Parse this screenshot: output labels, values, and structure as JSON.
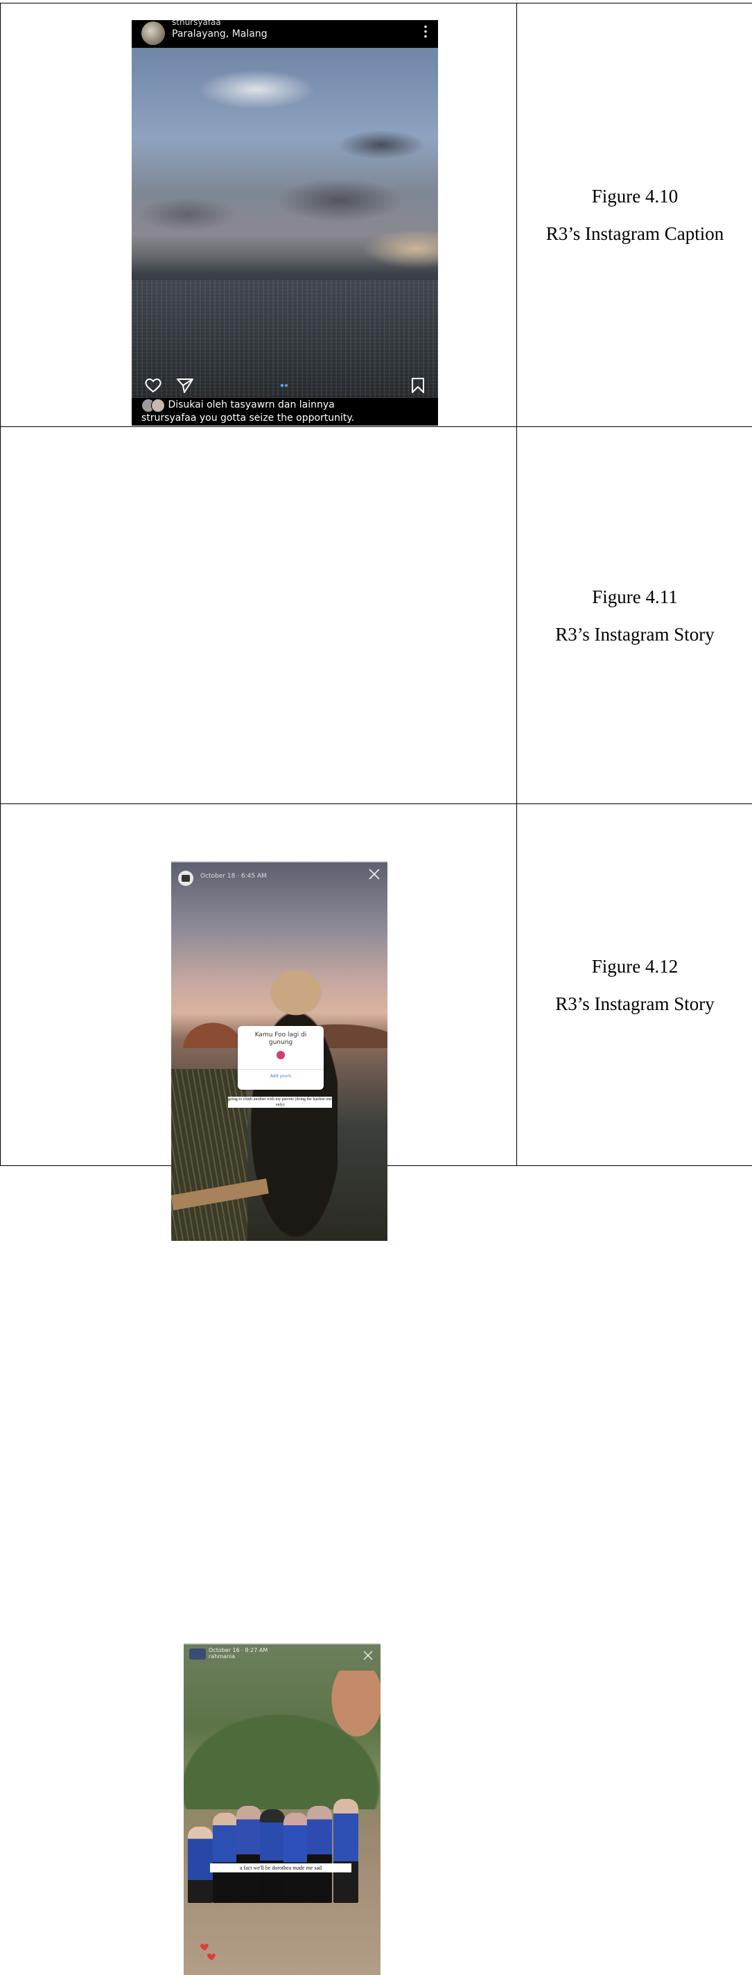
{
  "figures": [
    {
      "number": "Figure 4.10",
      "caption": "R3’s Instagram Caption"
    },
    {
      "number": "Figure 4.11",
      "caption": "R3’s Instagram Story"
    },
    {
      "number": "Figure 4.12",
      "caption": "R3’s Instagram Story"
    }
  ],
  "post": {
    "username": "stnursyafaa",
    "location": "Paralayang, Malang",
    "likes_text": "Disukai oleh tasyawrn dan lainnya",
    "caption_user": "strursyafaa",
    "caption_text": " you gotta seize the opportunity.",
    "accent": "#4aa3ff"
  },
  "story1": {
    "meta": "October 18 · 6:45 AM",
    "question": "Kamu Foo lagi di gunung",
    "reply_label": "Add yours",
    "text": "going to climb another with my parents (doing the hardest one only)"
  },
  "story2": {
    "meta": "October 16 · 8:27 AM",
    "sub": "rahmania",
    "text": "a fact we'll be dorothea made me sad"
  },
  "icons": {
    "heart": "heart-icon",
    "send": "send-icon",
    "bookmark": "bookmark-icon",
    "close": "close-icon",
    "more": "kebab-icon"
  }
}
